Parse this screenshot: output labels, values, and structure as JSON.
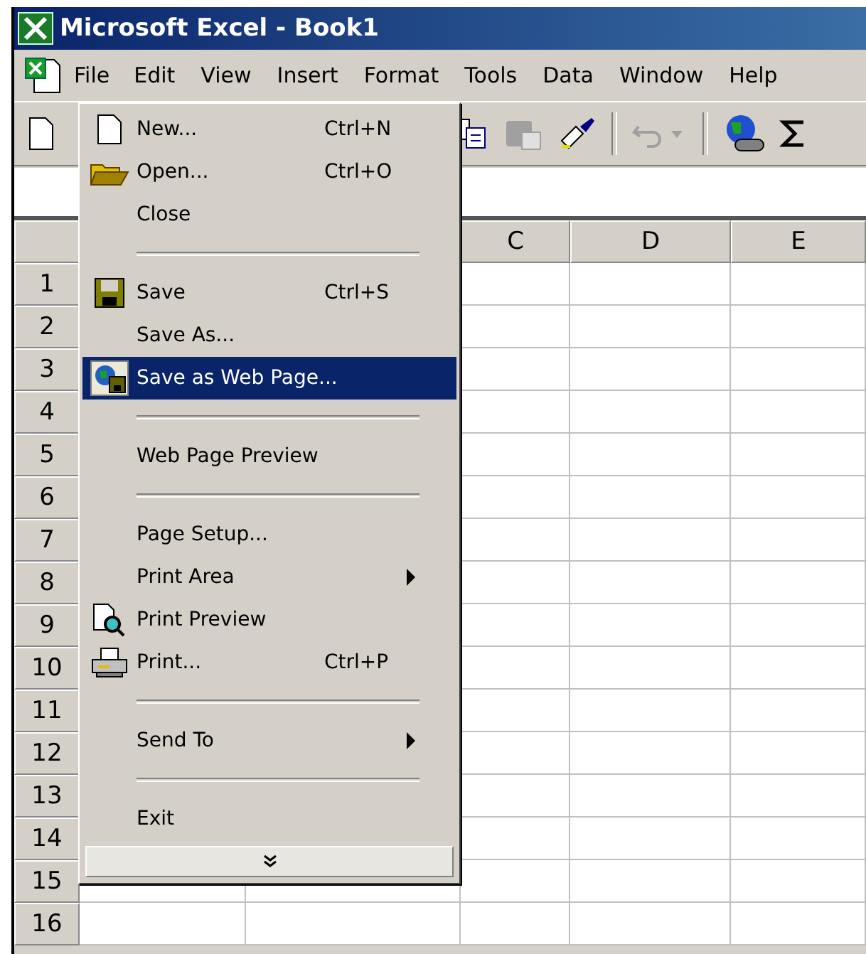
{
  "window": {
    "title": "Microsoft Excel - Book1"
  },
  "menu_bar": [
    {
      "label": "File",
      "selected": true
    },
    {
      "label": "Edit",
      "selected": false
    },
    {
      "label": "View",
      "selected": false
    },
    {
      "label": "Insert",
      "selected": false
    },
    {
      "label": "Format",
      "selected": false
    },
    {
      "label": "Tools",
      "selected": false
    },
    {
      "label": "Data",
      "selected": false
    },
    {
      "label": "Window",
      "selected": false
    },
    {
      "label": "Help",
      "selected": false
    }
  ],
  "sheet": {
    "columns": [
      "C",
      "D",
      "E"
    ],
    "rows": [
      "1",
      "2",
      "3",
      "4",
      "5",
      "6",
      "7",
      "8",
      "9",
      "10",
      "11",
      "12",
      "13",
      "14",
      "15",
      "16"
    ]
  },
  "file_menu": {
    "items": [
      {
        "kind": "item",
        "label": "New...",
        "shortcut": "Ctrl+N",
        "selected": false
      },
      {
        "kind": "item",
        "label": "Open...",
        "shortcut": "Ctrl+O",
        "selected": false
      },
      {
        "kind": "item",
        "label": "Close",
        "selected": false
      },
      {
        "kind": "separator"
      },
      {
        "kind": "item",
        "label": "Save",
        "shortcut": "Ctrl+S",
        "selected": false
      },
      {
        "kind": "item",
        "label": "Save As...",
        "selected": false
      },
      {
        "kind": "item",
        "label": "Save as Web Page...",
        "selected": true
      },
      {
        "kind": "separator"
      },
      {
        "kind": "item",
        "label": "Web Page Preview",
        "selected": false
      },
      {
        "kind": "separator"
      },
      {
        "kind": "item",
        "label": "Page Setup...",
        "selected": false
      },
      {
        "kind": "submenu",
        "label": "Print Area",
        "selected": false
      },
      {
        "kind": "item",
        "label": "Print Preview",
        "selected": false
      },
      {
        "kind": "item",
        "label": "Print...",
        "shortcut": "Ctrl+P",
        "selected": false
      },
      {
        "kind": "separator"
      },
      {
        "kind": "submenu",
        "label": "Send To",
        "selected": false
      },
      {
        "kind": "separator"
      },
      {
        "kind": "item",
        "label": "Exit",
        "selected": false
      },
      {
        "kind": "expand"
      }
    ]
  }
}
